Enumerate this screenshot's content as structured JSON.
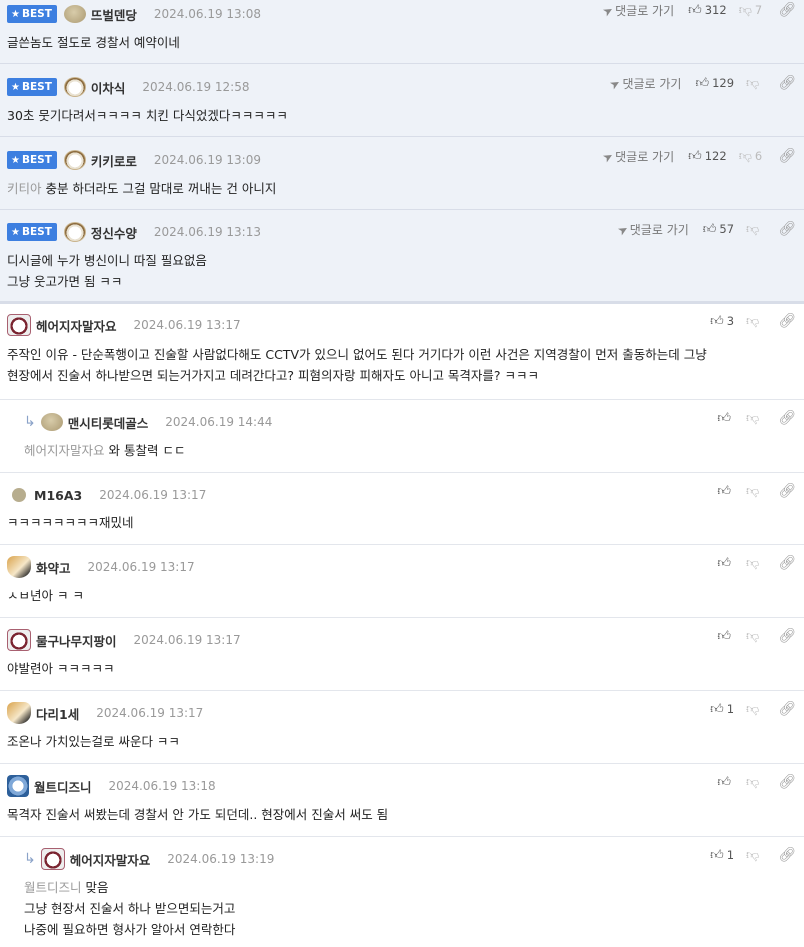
{
  "labels": {
    "best": "BEST",
    "goto": "댓글로 가기"
  },
  "icons": {
    "star": "star-icon",
    "thumb_up": "thumbs-up-icon",
    "thumb_down": "thumbs-down-icon",
    "link": "link-icon",
    "reply": "reply-arrow-icon",
    "goto": "navigation-arrow-icon"
  },
  "colors": {
    "best_badge": "#3d7fe0",
    "best_bg": "#eef2f8"
  },
  "comments": [
    {
      "nick": "뜨벌덴당",
      "date": "2024.06.19 13:08",
      "up": "312",
      "down": "7",
      "line1": "글쓴놈도 절도로 경찰서 예약이네",
      "line2": "",
      "mention": ""
    },
    {
      "nick": "이차식",
      "date": "2024.06.19 12:58",
      "up": "129",
      "down": "",
      "line1": "30초 뭇기다려서ㅋㅋㅋㅋ 치킨 다식었겠다ㅋㅋㅋㅋㅋ",
      "line2": "",
      "mention": ""
    },
    {
      "nick": "키키로로",
      "date": "2024.06.19 13:09",
      "up": "122",
      "down": "6",
      "line1": "충분 하더라도 그걸 맘대로 꺼내는 건 아니지",
      "line2": "",
      "mention": "키티아"
    },
    {
      "nick": "정신수양",
      "date": "2024.06.19 13:13",
      "up": "57",
      "down": "",
      "line1": "디시글에 누가 병신이니 따질 필요없음",
      "line2": "그냥 웃고가면 됨 ㅋㅋ",
      "mention": ""
    },
    {
      "nick": "헤어지자말자요",
      "date": "2024.06.19 13:17",
      "up": "3",
      "down": "",
      "line1": "주작인 이유 - 단순폭행이고 진술할 사람없다해도 CCTV가 있으니 없어도 된다 거기다가 이런 사건은 지역경찰이 먼저 출동하는데 그냥",
      "line2": "현장에서 진술서 하나받으면 되는거가지고 데려간다고? 피혐의자랑 피해자도 아니고 목격자를? ㅋㅋㅋ",
      "mention": ""
    },
    {
      "nick": "맨시티롯데골스",
      "date": "2024.06.19 14:44",
      "up": "",
      "down": "",
      "line1": "와 통찰력 ㄷㄷ",
      "line2": "",
      "mention": "헤어지자말자요"
    },
    {
      "nick": "M16A3",
      "date": "2024.06.19 13:17",
      "up": "",
      "down": "",
      "line1": "ㅋㅋㅋㅋㅋㅋㅋㅋ재밌네",
      "line2": "",
      "mention": ""
    },
    {
      "nick": "화약고",
      "date": "2024.06.19 13:17",
      "up": "",
      "down": "",
      "line1": "ㅅㅂ년아 ㅋ ㅋ",
      "line2": "",
      "mention": ""
    },
    {
      "nick": "물구나무지팡이",
      "date": "2024.06.19 13:17",
      "up": "",
      "down": "",
      "line1": "야발련아 ㅋㅋㅋㅋㅋ",
      "line2": "",
      "mention": ""
    },
    {
      "nick": "다리1세",
      "date": "2024.06.19 13:17",
      "up": "1",
      "down": "",
      "line1": "조온나 가치있는걸로 싸운다 ㅋㅋ",
      "line2": "",
      "mention": ""
    },
    {
      "nick": "월트디즈니",
      "date": "2024.06.19 13:18",
      "up": "",
      "down": "",
      "line1": "목격자 진술서 써봤는데 경찰서 안 가도 되던데.. 현장에서 진술서 써도 됨",
      "line2": "",
      "mention": ""
    },
    {
      "nick": "헤어지자말자요",
      "date": "2024.06.19 13:19",
      "up": "1",
      "down": "",
      "line1": "맞음",
      "line2": "그냥 현장서 진술서 하나 받으면되는거고",
      "line3": "나중에 필요하면 형사가 알아서 연락한다",
      "mention": "월트디즈니"
    }
  ]
}
